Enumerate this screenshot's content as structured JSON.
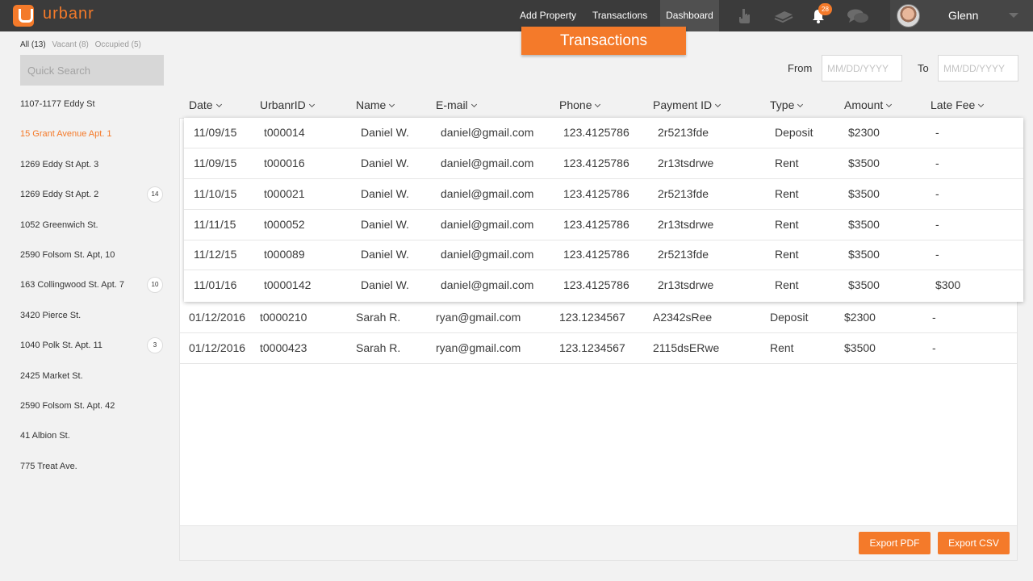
{
  "app": {
    "logo_text": "urbanr"
  },
  "topnav": {
    "add_property": "Add Property",
    "transactions": "Transactions",
    "dashboard": "Dashboard",
    "notification_count": "28",
    "user_name": "Glenn"
  },
  "page": {
    "banner": "Transactions"
  },
  "sidebar": {
    "filters": {
      "all": "All (13)",
      "vacant": "Vacant (8)",
      "occupied": "Occupied (5)"
    },
    "search_placeholder": "Quick Search",
    "properties": [
      {
        "name": "1107-1177 Eddy St",
        "badge": ""
      },
      {
        "name": "15 Grant Avenue Apt. 1",
        "badge": "",
        "selected": true
      },
      {
        "name": "1269 Eddy St Apt. 3",
        "badge": ""
      },
      {
        "name": "1269 Eddy St Apt. 2",
        "badge": "14"
      },
      {
        "name": "1052 Greenwich St.",
        "badge": ""
      },
      {
        "name": "2590 Folsom St. Apt, 10",
        "badge": ""
      },
      {
        "name": "163 Collingwood St. Apt. 7",
        "badge": "10"
      },
      {
        "name": "3420 Pierce St.",
        "badge": ""
      },
      {
        "name": "1040 Polk St. Apt. 11",
        "badge": "3"
      },
      {
        "name": "2425 Market St.",
        "badge": ""
      },
      {
        "name": "2590 Folsom St. Apt. 42",
        "badge": ""
      },
      {
        "name": "41 Albion St.",
        "badge": ""
      },
      {
        "name": "775 Treat Ave.",
        "badge": ""
      }
    ]
  },
  "filters": {
    "from_label": "From",
    "to_label": "To",
    "from_placeholder": "MM/DD/YYYY",
    "to_placeholder": "MM/DD/YYYY"
  },
  "table": {
    "headers": [
      "Date",
      "UrbanrID",
      "Name",
      "E-mail",
      "Phone",
      "Payment ID",
      "Type",
      "Amount",
      "Late Fee"
    ],
    "expanded_rows": [
      [
        "11/09/15",
        "t000014",
        "Daniel W.",
        "daniel@gmail.com",
        "123.4125786",
        "2r5213fde",
        "Deposit",
        "$2300",
        "-"
      ],
      [
        "11/09/15",
        "t000016",
        "Daniel W.",
        "daniel@gmail.com",
        "123.4125786",
        "2r13tsdrwe",
        "Rent",
        "$3500",
        "-"
      ],
      [
        "11/10/15",
        "t000021",
        "Daniel W.",
        "daniel@gmail.com",
        "123.4125786",
        "2r5213fde",
        "Rent",
        "$3500",
        "-"
      ],
      [
        "11/11/15",
        "t000052",
        "Daniel W.",
        "daniel@gmail.com",
        "123.4125786",
        "2r13tsdrwe",
        "Rent",
        "$3500",
        "-"
      ],
      [
        "11/12/15",
        "t000089",
        "Daniel W.",
        "daniel@gmail.com",
        "123.4125786",
        "2r5213fde",
        "Rent",
        "$3500",
        "-"
      ],
      [
        "11/01/16",
        "t0000142",
        "Daniel W.",
        "daniel@gmail.com",
        "123.4125786",
        "2r13tsdrwe",
        "Rent",
        "$3500",
        "$300"
      ]
    ],
    "rows": [
      [
        "01/12/2016",
        "t0000210",
        "Sarah R.",
        "ryan@gmail.com",
        "123.1234567",
        "A2342sRee",
        "Deposit",
        "$2300",
        "-"
      ],
      [
        "01/12/2016",
        "t0000423",
        "Sarah R.",
        "ryan@gmail.com",
        "123.1234567",
        "2115dsERwe",
        "Rent",
        "$3500",
        "-"
      ]
    ]
  },
  "actions": {
    "export_pdf": "Export PDF",
    "export_csv": "Export CSV"
  },
  "colors": {
    "accent": "#f47a2a",
    "topbar": "#3b3b3b"
  }
}
